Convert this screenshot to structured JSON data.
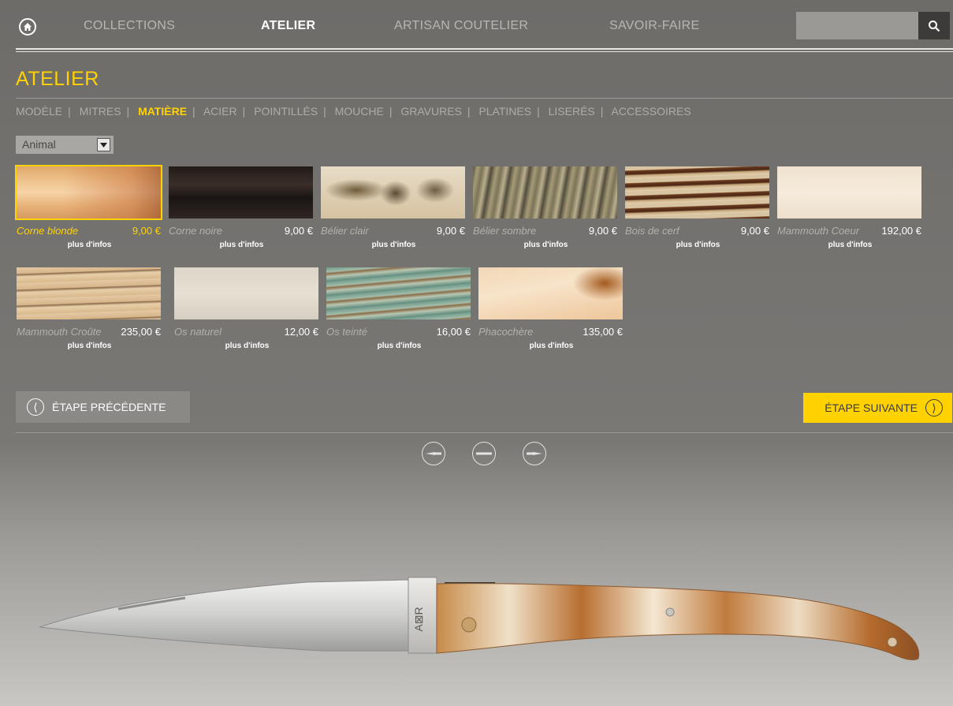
{
  "nav": {
    "items": [
      "COLLECTIONS",
      "ATELIER",
      "ARTISAN COUTELIER",
      "SAVOIR-FAIRE"
    ],
    "active": "ATELIER"
  },
  "search": {
    "placeholder": ""
  },
  "page": {
    "title": "ATELIER"
  },
  "subnav": {
    "items": [
      "MODÈLE",
      "MITRES",
      "MATIÈRE",
      "ACIER",
      "POINTILLÉS",
      "MOUCHE",
      "GRAVURES",
      "PLATINES",
      "LISERÉS",
      "ACCESSOIRES"
    ],
    "active": "MATIÈRE"
  },
  "filter": {
    "selected": "Animal"
  },
  "materials": [
    {
      "name": "Corne blonde",
      "price": "9,00 €",
      "info": "plus d'infos",
      "selected": true
    },
    {
      "name": "Corne noire",
      "price": "9,00 €",
      "info": "plus d'infos"
    },
    {
      "name": "Bélier clair",
      "price": "9,00 €",
      "info": "plus d'infos"
    },
    {
      "name": "Bélier sombre",
      "price": "9,00 €",
      "info": "plus d'infos"
    },
    {
      "name": "Bois de cerf",
      "price": "9,00 €",
      "info": "plus d'infos"
    },
    {
      "name": "Mammouth Coeur",
      "price": "192,00 €",
      "info": "plus d'infos"
    },
    {
      "name": "Mammouth Croûte",
      "price": "235,00 €",
      "info": "plus d'infos"
    },
    {
      "name": "Os naturel",
      "price": "12,00 €",
      "info": "plus d'infos"
    },
    {
      "name": "Os teinté",
      "price": "16,00 €",
      "info": "plus d'infos"
    },
    {
      "name": "Phacochère",
      "price": "135,00 €",
      "info": "plus d'infos"
    }
  ],
  "buttons": {
    "prev": "ÉTAPE PRÉCÉDENTE",
    "next": "ÉTAPE SUIVANTE"
  },
  "preview": {
    "engraving": "A⊠R"
  },
  "colors": {
    "accent": "#ffd200"
  }
}
